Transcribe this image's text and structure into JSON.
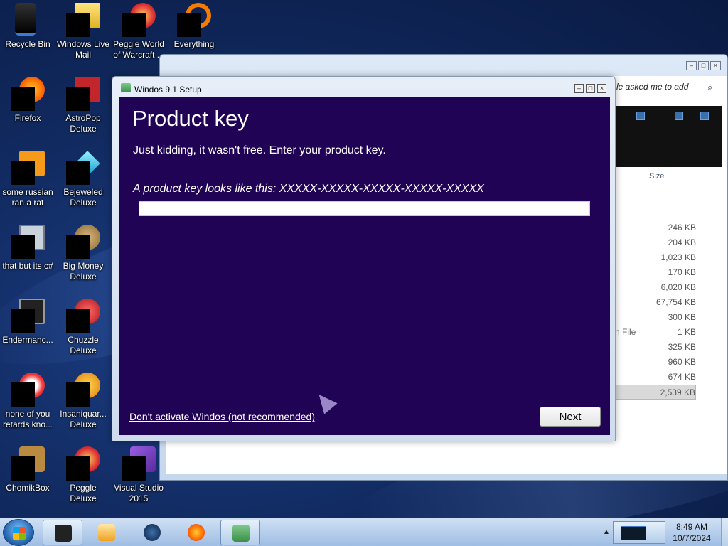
{
  "desktop": {
    "icons": [
      {
        "label": "Recycle Bin"
      },
      {
        "label": "Windows Live Mail"
      },
      {
        "label": "Peggle World of Warcraft ..."
      },
      {
        "label": "Everything"
      },
      {
        "label": "Firefox"
      },
      {
        "label": "AstroPop Deluxe"
      },
      {
        "label": "some russian ran a rat"
      },
      {
        "label": "Bejeweled Deluxe"
      },
      {
        "label": "that but its c#"
      },
      {
        "label": "Big Money Deluxe"
      },
      {
        "label": "Endermanc..."
      },
      {
        "label": "Chuzzle Deluxe"
      },
      {
        "label": "none of you retards kno..."
      },
      {
        "label": "Insaniquar... Deluxe"
      },
      {
        "label": "ChomikBox"
      },
      {
        "label": "Peggle Deluxe"
      },
      {
        "label": "Visual Studio 2015"
      }
    ]
  },
  "explorer": {
    "search_text": "le asked me to add",
    "size_header": "Size",
    "type_fragment": "h File",
    "sizes": [
      "246 KB",
      "204 KB",
      "1,023 KB",
      "170 KB",
      "6,020 KB",
      "67,754 KB",
      "300 KB",
      "1 KB",
      "325 KB",
      "960 KB",
      "674 KB",
      "2,539 KB"
    ]
  },
  "dialog": {
    "title": "Windos 9.1 Setup",
    "heading": "Product key",
    "subtitle": "Just kidding, it wasn't free. Enter your product key.",
    "hint": "A product key looks like this: XXXXX-XXXXX-XXXXX-XXXXX-XXXXX",
    "key_value": "",
    "skip_link": "Don't activate Windos (not recommended)",
    "next_label": "Next"
  },
  "taskbar": {
    "time": "8:49 AM",
    "date": "10/7/2024"
  }
}
